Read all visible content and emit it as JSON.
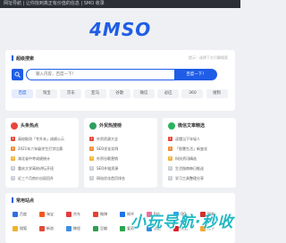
{
  "topbar": {
    "text": "网址导航 | 让你找到真正有价值的信息 | SMO 收录"
  },
  "logo": {
    "text": "4MSO",
    "color": "#1f5de6"
  },
  "search": {
    "title": "超级搜索",
    "note": "提示：选择下方引擎搜索",
    "placeholder": "输入内容，百度一下！",
    "button_label": "百度一下！",
    "engines": [
      {
        "label": "百度",
        "active": true
      },
      {
        "label": "淘宝",
        "active": false
      },
      {
        "label": "京东",
        "active": false
      },
      {
        "label": "亚马",
        "active": false
      },
      {
        "label": "谷歌",
        "active": false
      },
      {
        "label": "微信",
        "active": false
      },
      {
        "label": "必应",
        "active": false
      },
      {
        "label": "360",
        "active": false
      },
      {
        "label": "搜狗",
        "active": false
      }
    ]
  },
  "columns": [
    {
      "title": "头条热点",
      "icon": "fire-icon",
      "color": "#e8463c",
      "items": [
        "高校取消「专升本」成绩公示",
        "2021年六年级学生打字比赛",
        "湖北省中考成绩统计",
        "重庆大学高校讲坛开班",
        "近三个月房价出现回升"
      ]
    },
    {
      "title": "外贸热搜榜",
      "icon": "chart-icon",
      "color": "#2e9f5d",
      "items": [
        "外贸资源大全",
        "SEO优化实例",
        "外贸谷歌营销",
        "SEO外链资源",
        "网站优化首页排名"
      ]
    },
    {
      "title": "微信文章精选",
      "icon": "wechat-icon",
      "color": "#2bb35c",
      "items": [
        "读懂当下年轻人",
        "「智慧生活」新变化",
        "科技资讯精选",
        "生活指南每日推送",
        "学习工具整理分享"
      ]
    }
  ],
  "sites": {
    "title": "常用站点",
    "items": [
      {
        "label": "百度",
        "color": "#2f6fe4"
      },
      {
        "label": "淘宝",
        "color": "#f45a1a"
      },
      {
        "label": "京东",
        "color": "#e23c3c"
      },
      {
        "label": "微博",
        "color": "#e6412f"
      },
      {
        "label": "知乎",
        "color": "#1f73e6"
      },
      {
        "label": "B站",
        "color": "#ef6e98"
      },
      {
        "label": "QQ",
        "color": "#2fa5ef"
      },
      {
        "label": "网易",
        "color": "#d3302a"
      },
      {
        "label": "搜狐",
        "color": "#f0b32c"
      },
      {
        "label": "新浪",
        "color": "#e14b3a"
      },
      {
        "label": "携程",
        "color": "#3d8de0"
      },
      {
        "label": "豆瓣",
        "color": "#2f9e4f"
      },
      {
        "label": "爱奇",
        "color": "#27a64b"
      },
      {
        "label": "优酷",
        "color": "#2f8de4"
      },
      {
        "label": "天猫",
        "color": "#d9232d"
      },
      {
        "label": "苏宁",
        "color": "#f3a735"
      }
    ]
  },
  "watermark": {
    "text": "小玩导航·秒收"
  }
}
